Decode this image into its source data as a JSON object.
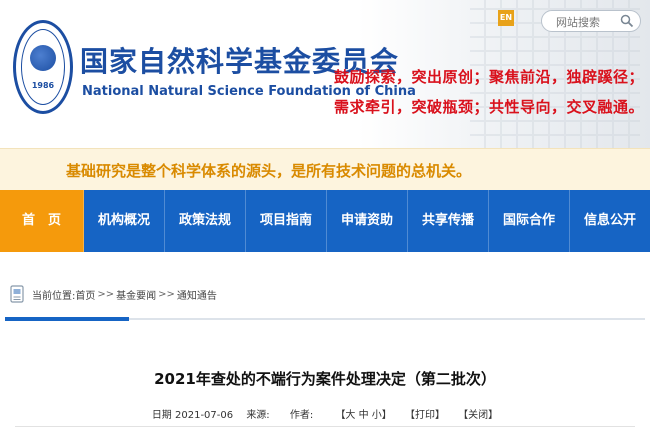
{
  "header": {
    "cn_title": "国家自然科学基金委员会",
    "en_title": "National Natural Science Foundation of China",
    "logo_year": "1986",
    "lang_button": "EN",
    "search_placeholder": "网站搜索",
    "slogan_line1": "鼓励探索，突出原创；聚焦前沿，独辟蹊径；",
    "slogan_line2": "需求牵引，突破瓶颈；共性导向，交叉融通。"
  },
  "motto": "基础研究是整个科学体系的源头，是所有技术问题的总机关。",
  "nav": [
    {
      "label": "首　页",
      "active": true
    },
    {
      "label": "机构概况"
    },
    {
      "label": "政策法规"
    },
    {
      "label": "项目指南"
    },
    {
      "label": "申请资助"
    },
    {
      "label": "共享传播"
    },
    {
      "label": "国际合作"
    },
    {
      "label": "信息公开"
    }
  ],
  "breadcrumb": {
    "prefix": "当前位置:",
    "items": [
      "首页",
      "基金要闻",
      "通知通告"
    ],
    "sep": ">>"
  },
  "article": {
    "title": "2021年查处的不端行为案件处理决定（第二批次）",
    "date_label": "日期",
    "date": "2021-07-06",
    "source_label": "来源:",
    "author_label": "作者:",
    "font_size": "【大 中 小】",
    "print": "【打印】",
    "close": "【关闭】"
  },
  "colors": {
    "brand_blue": "#1c4ea2",
    "nav_blue": "#1664c4",
    "nav_active": "#f59a0c",
    "slogan_red": "#d9111c",
    "motto_orange": "#d98a00"
  }
}
